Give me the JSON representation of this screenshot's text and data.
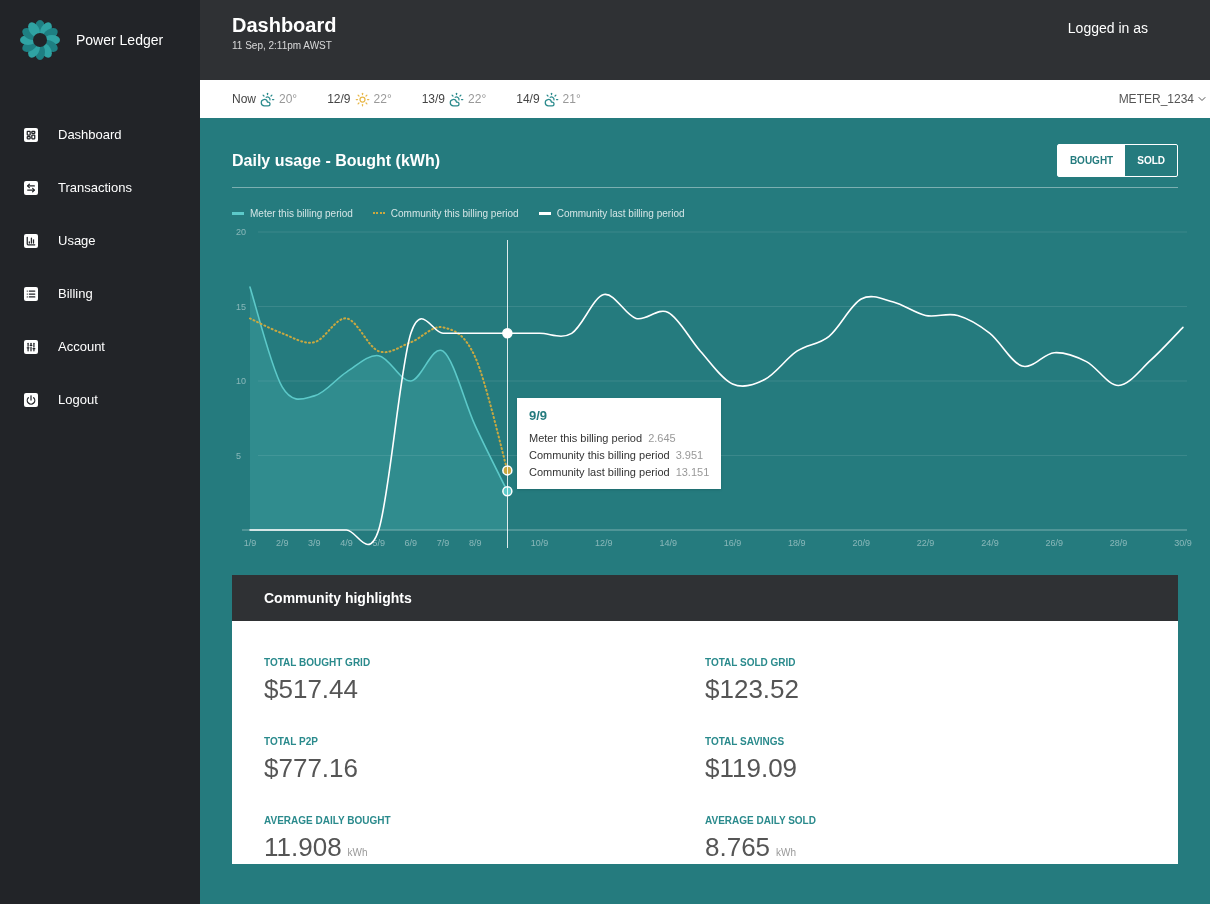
{
  "sidebar": {
    "brand": "Power Ledger",
    "items": [
      {
        "label": "Dashboard",
        "kind": "dashboard"
      },
      {
        "label": "Transactions",
        "kind": "transactions"
      },
      {
        "label": "Usage",
        "kind": "usage"
      },
      {
        "label": "Billing",
        "kind": "billing"
      },
      {
        "label": "Account",
        "kind": "account"
      },
      {
        "label": "Logout",
        "kind": "logout"
      }
    ]
  },
  "header": {
    "title": "Dashboard",
    "subtitle": "11 Sep, 2:11pm AWST",
    "user_label": "Logged in as"
  },
  "weather": [
    {
      "day": "Now",
      "kind": "cloudy",
      "temp": "20°"
    },
    {
      "day": "12/9",
      "kind": "sunny",
      "temp": "22°"
    },
    {
      "day": "13/9",
      "kind": "cloudy",
      "temp": "22°"
    },
    {
      "day": "14/9",
      "kind": "cloudy",
      "temp": "21°"
    }
  ],
  "meter_select": {
    "value": "METER_1234"
  },
  "usage": {
    "title": "Daily usage - Bought (kWh)",
    "toggle": [
      {
        "label": "BOUGHT",
        "selected": true
      },
      {
        "label": "SOLD",
        "selected": false
      }
    ],
    "chart_data": {
      "type": "line",
      "grid": true,
      "legend": "top-left",
      "ylim": [
        0,
        20
      ],
      "yticks": [
        5,
        10,
        15,
        20
      ],
      "categories": [
        "1/9",
        "2/9",
        "3/9",
        "4/9",
        "5/9",
        "6/9",
        "7/9",
        "8/9",
        null,
        "10/9",
        null,
        "12/9",
        null,
        "14/9",
        null,
        "16/9",
        null,
        "18/9",
        null,
        "20/9",
        null,
        "22/9",
        null,
        "24/9",
        null,
        "26/9",
        null,
        "28/9",
        null,
        "30/9"
      ],
      "series": [
        {
          "name": "Meter this billing period",
          "color": "#5cc9c9",
          "line_style": "solid",
          "values": [
            16.3,
            9.6,
            9.0,
            10.6,
            11.7,
            10.0,
            12.0,
            7.0,
            2.6,
            null,
            null,
            null,
            null,
            null,
            null,
            null,
            null,
            null,
            null,
            null,
            null,
            null,
            null,
            null,
            null,
            null,
            null,
            null,
            null,
            null
          ]
        },
        {
          "name": "Community this billing period",
          "color": "#c9a840",
          "line_style": "dotted",
          "values": [
            14.2,
            13.2,
            12.6,
            14.2,
            12.0,
            12.6,
            13.6,
            11.6,
            4.0,
            null,
            null,
            null,
            null,
            null,
            null,
            null,
            null,
            null,
            null,
            null,
            null,
            null,
            null,
            null,
            null,
            null,
            null,
            null,
            null,
            null
          ]
        },
        {
          "name": "Community last billing period",
          "color": "#ffffff",
          "line_style": "solid",
          "values": [
            0,
            0,
            0,
            0,
            0,
            13.2,
            13.2,
            13.2,
            13.2,
            13.2,
            13.2,
            15.8,
            14.2,
            14.6,
            12.0,
            9.8,
            10.1,
            12.0,
            13.0,
            15.5,
            15.3,
            14.4,
            14.4,
            13.2,
            11.0,
            11.9,
            11.3,
            9.7,
            11.4,
            13.6
          ]
        }
      ]
    },
    "tooltip": {
      "title": "9/9",
      "rows": [
        {
          "label": "Meter this billing period",
          "value": "2.645"
        },
        {
          "label": "Community this billing period",
          "value": "3.951"
        },
        {
          "label": "Community last billing period",
          "value": "13.151"
        }
      ]
    }
  },
  "highlights": {
    "title": "Community highlights",
    "stats": [
      {
        "label": "TOTAL BOUGHT GRID",
        "value": "$517.44"
      },
      {
        "label": "TOTAL SOLD GRID",
        "value": "$123.52"
      },
      {
        "label": "TOTAL P2P",
        "value": "$777.16"
      },
      {
        "label": "TOTAL SAVINGS",
        "value": "$119.09"
      },
      {
        "label": "AVERAGE DAILY BOUGHT",
        "value": "11.908",
        "unit": "kWh"
      },
      {
        "label": "AVERAGE DAILY SOLD",
        "value": "8.765",
        "unit": "kWh"
      }
    ]
  }
}
